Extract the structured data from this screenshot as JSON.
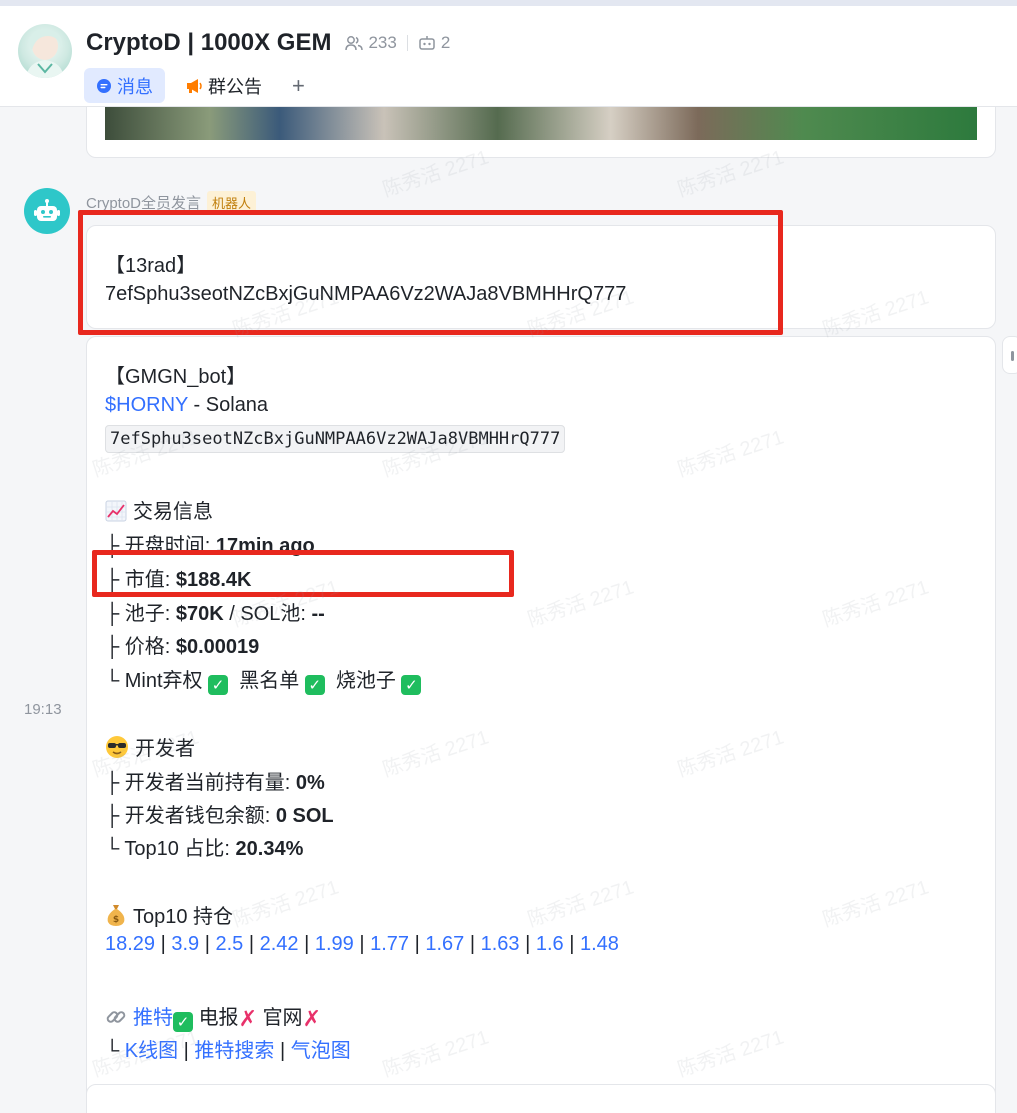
{
  "header": {
    "title": "CryptoD | 1000X GEM",
    "member_count": "233",
    "bot_count": "2",
    "tabs": [
      {
        "label": "消息",
        "active": true,
        "icon": "chat-bubble-icon"
      },
      {
        "label": "群公告",
        "active": false,
        "icon": "megaphone-icon"
      }
    ],
    "add_tab": "+"
  },
  "message": {
    "sender": "CryptoD全员发言",
    "sender_badge": "机器人",
    "time": "19:13"
  },
  "card1": {
    "title": "【13rad】",
    "address": "7efSphu3seotNZcBxjGuNMPAA6Vz2WAJa8VBMHHrQ777"
  },
  "card2": {
    "bot_title": "【GMGN_bot】",
    "ticker": "$HORNY",
    "chain_sep": " - ",
    "chain": "Solana",
    "address": "7efSphu3seotNZcBxjGuNMPAA6Vz2WAJa8VBMHHrQ777",
    "trade_section": {
      "heading": "交易信息",
      "open_time_label": "├ 开盘时间: ",
      "open_time_value": "17min ago",
      "mcap_label": "├ 市值: ",
      "mcap_value": "$188.4K",
      "pool_label": "├ 池子: ",
      "pool_value": "$70K",
      "sol_pool_label": " / SOL池: ",
      "sol_pool_value": "--",
      "price_label": "├ 价格: ",
      "price_value": "$0.00019",
      "checks_prefix": "└ ",
      "check_mint": "Mint弃权",
      "check_blacklist": "黑名单",
      "check_burn": "烧池子",
      "check_mark": "✓"
    },
    "dev_section": {
      "heading": "开发者",
      "hold_label": "├ 开发者当前持有量: ",
      "hold_value": "0%",
      "wallet_label": "├ 开发者钱包余额: ",
      "wallet_value": "0 SOL",
      "top10_label": "└ Top10 占比: ",
      "top10_value": "20.34%"
    },
    "top10_section": {
      "heading": "Top10 持仓",
      "holders": [
        "18.29",
        "3.9",
        "2.5",
        "2.42",
        "1.99",
        "1.77",
        "1.67",
        "1.63",
        "1.6",
        "1.48"
      ],
      "separator": " | "
    },
    "links_section": {
      "twitter": "推特",
      "telegram": "电报",
      "website": "官网",
      "cross_mark": "✗",
      "prefix": "└ ",
      "kline": "K线图",
      "twitter_search": "推特搜索",
      "bubble_map": "气泡图",
      "sep": " | "
    }
  },
  "watermark_text": "陈秀活 2271",
  "colors": {
    "accent": "#3370ff",
    "highlight": "#e8281e",
    "check_green": "#1fbd5e",
    "cross_red": "#e8316a"
  }
}
